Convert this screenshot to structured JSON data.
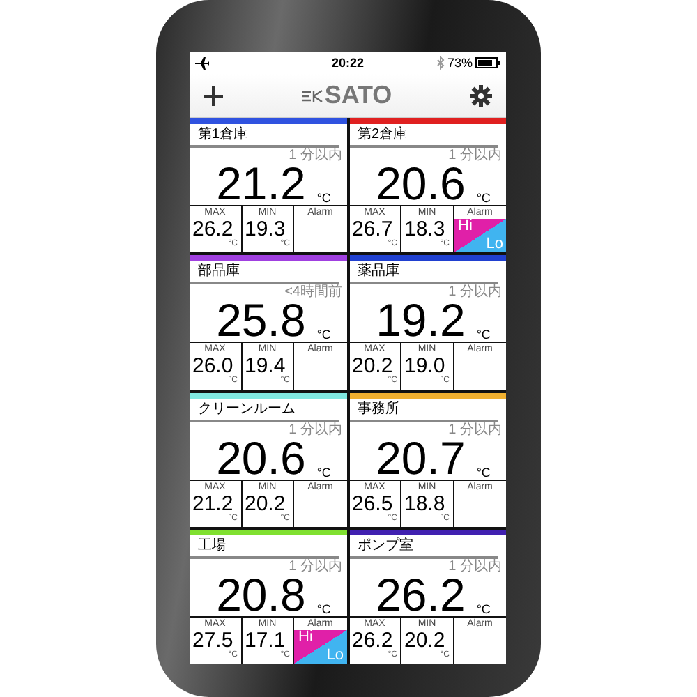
{
  "status_bar": {
    "time": "20:22",
    "battery": "73%"
  },
  "header": {
    "logo": "SATO"
  },
  "sensors": [
    {
      "name": "第1倉庫",
      "color": "#2f52e0",
      "updated": "1 分以内",
      "value": "21.2",
      "unit": "°C",
      "max": {
        "label": "MAX",
        "value": "26.2",
        "unit": "°C"
      },
      "min": {
        "label": "MIN",
        "value": "19.3",
        "unit": "°C"
      },
      "alarm_label": "Alarm"
    },
    {
      "name": "第2倉庫",
      "color": "#e02020",
      "updated": "1 分以内",
      "value": "20.6",
      "unit": "°C",
      "max": {
        "label": "MAX",
        "value": "26.7",
        "unit": "°C"
      },
      "min": {
        "label": "MIN",
        "value": "18.3",
        "unit": "°C"
      },
      "alarm_label": "Alarm",
      "alarm_hi": "Hi",
      "alarm_lo": "Lo"
    },
    {
      "name": "部品庫",
      "color": "#a040e0",
      "updated": "<4時間前",
      "value": "25.8",
      "unit": "°C",
      "max": {
        "label": "MAX",
        "value": "26.0",
        "unit": "°C"
      },
      "min": {
        "label": "MIN",
        "value": "19.4",
        "unit": "°C"
      },
      "alarm_label": "Alarm"
    },
    {
      "name": "薬品庫",
      "color": "#2040d0",
      "updated": "1 分以内",
      "value": "19.2",
      "unit": "°C",
      "max": {
        "label": "MAX",
        "value": "20.2",
        "unit": "°C"
      },
      "min": {
        "label": "MIN",
        "value": "19.0",
        "unit": "°C"
      },
      "alarm_label": "Alarm"
    },
    {
      "name": "クリーンルーム",
      "color": "#80e8e0",
      "updated": "1 分以内",
      "value": "20.6",
      "unit": "°C",
      "max": {
        "label": "MAX",
        "value": "21.2",
        "unit": "°C"
      },
      "min": {
        "label": "MIN",
        "value": "20.2",
        "unit": "°C"
      },
      "alarm_label": "Alarm"
    },
    {
      "name": "事務所",
      "color": "#f0b030",
      "updated": "1 分以内",
      "value": "20.7",
      "unit": "°C",
      "max": {
        "label": "MAX",
        "value": "26.5",
        "unit": "°C"
      },
      "min": {
        "label": "MIN",
        "value": "18.8",
        "unit": "°C"
      },
      "alarm_label": "Alarm"
    },
    {
      "name": "工場",
      "color": "#80e030",
      "updated": "1 分以内",
      "value": "20.8",
      "unit": "°C",
      "max": {
        "label": "MAX",
        "value": "27.5",
        "unit": "°C"
      },
      "min": {
        "label": "MIN",
        "value": "17.1",
        "unit": "°C"
      },
      "alarm_label": "Alarm",
      "alarm_hi": "Hi",
      "alarm_lo": "Lo"
    },
    {
      "name": "ポンプ室",
      "color": "#4020b0",
      "updated": "1 分以内",
      "value": "26.2",
      "unit": "°C",
      "max": {
        "label": "MAX",
        "value": "26.2",
        "unit": "°C"
      },
      "min": {
        "label": "MIN",
        "value": "20.2",
        "unit": "°C"
      },
      "alarm_label": "Alarm"
    }
  ]
}
